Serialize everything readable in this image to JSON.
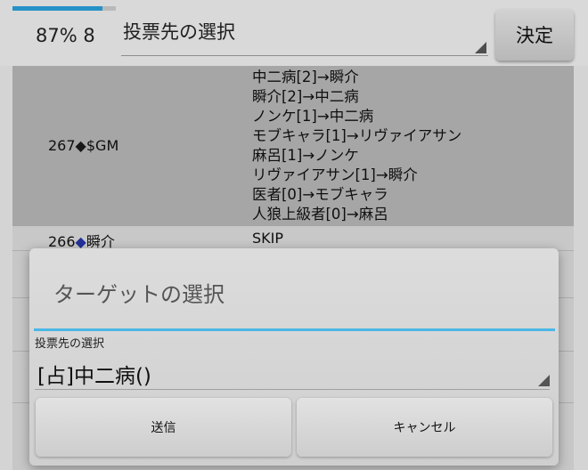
{
  "header": {
    "progress_percent": 87,
    "status_text": "87% 8",
    "vote_select_label": "投票先の選択",
    "decide_label": "決定"
  },
  "log": {
    "rows": [
      {
        "id": "267",
        "name": "$GM",
        "lines": [
          "中二病[2]→瞬介",
          "瞬介[2]→中二病",
          "ノンケ[1]→中二病",
          "モブキャラ[1]→リヴァイアサン",
          "麻呂[1]→ノンケ",
          "リヴァイアサン[1]→瞬介",
          "医者[0]→モブキャラ",
          "人狼上級者[0]→麻呂"
        ]
      },
      {
        "id": "266",
        "name": "瞬介",
        "lines": [
          "SKIP"
        ]
      }
    ]
  },
  "dialog": {
    "title": "ターゲットの選択",
    "field_label": "投票先の選択",
    "selected_target": "[占]中二病()",
    "send_label": "送信",
    "cancel_label": "キャンセル"
  },
  "colors": {
    "accent": "#4bb7e6",
    "progress": "#2a9fd8",
    "diamond_highlight": "#2636a8"
  }
}
